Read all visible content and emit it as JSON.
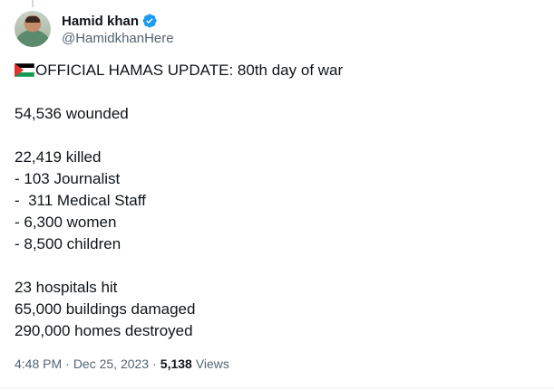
{
  "author": {
    "display_name": "Hamid khan",
    "handle": "@HamidkhanHere",
    "verified": true,
    "verified_color": "#1d9bf0"
  },
  "tweet": {
    "flag_emoji": "palestine-flag-icon",
    "headline": "OFFICIAL HAMAS UPDATE: 80th day of war",
    "wounded": "54,536 wounded",
    "killed": "22,419 killed",
    "killed_breakdown": [
      "- 103 Journalist",
      "-  311 Medical Staff",
      "- 6,300 women",
      "- 8,500 children"
    ],
    "damage": [
      "23 hospitals hit",
      "65,000 buildings damaged",
      "290,000 homes destroyed"
    ]
  },
  "meta": {
    "time": "4:48 PM",
    "separator": "·",
    "date": "Dec 25, 2023",
    "views_count": "5,138",
    "views_label": "Views"
  }
}
